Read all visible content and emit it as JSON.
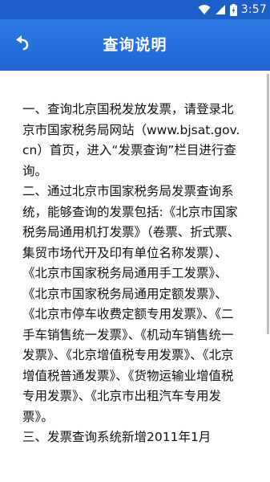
{
  "status_bar": {
    "time": "3:57",
    "icons": [
      "wifi-icon",
      "cell-signal-icon",
      "battery-icon"
    ]
  },
  "header": {
    "title": "查询说明",
    "back_icon": "back-arrow-icon"
  },
  "content": {
    "text": "一、查询北京国税发放发票，请登录北京市国家税务局网站（www.bjsat.gov.cn）首页，进入“发票查询”栏目进行查询。\n二、通过北京市国家税务局发票查询系统，能够查询的发票包括:《北京市国家税务局通用机打发票》（卷票、折式票、集贸市场代开及印有单位名称发票）、《北京市国家税务局通用手工发票》、《北京市国家税务局通用定额发票》、《北京市停车收费定额专用发票》、《二手车销售统一发票》、《机动车销售统一发票》、《北京增值税专用发票》、《北京增值税普通发票》、《货物运输业增值税专用发票》、《北京市出租汽车专用发票》。\n三、发票查询系统新增2011年1月"
  },
  "colors": {
    "status_bar": "#1d5ec9",
    "app_bar": "#2270dd",
    "text": "#111111"
  }
}
